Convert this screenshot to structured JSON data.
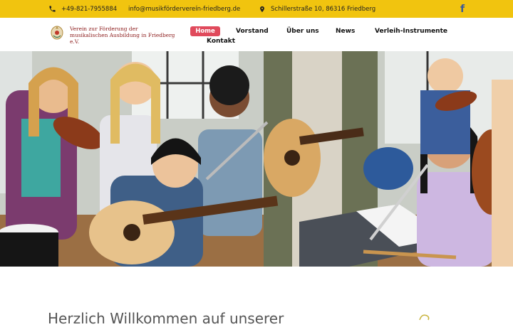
{
  "topbar": {
    "phone": "+49-821-7955884",
    "email": "info@musikfördervereín-friedberg.de",
    "address": "Schillerstraße 10, 86316 Friedberg",
    "social_icon": "facebook-icon",
    "background_color": "#f1c40f"
  },
  "brand": {
    "line1": "Verein zur Förderung der",
    "line2": "musikalischen Ausbildung in Friedberg e.V.",
    "color": "#8b1a1a"
  },
  "nav": {
    "items": [
      "Home",
      "Vorstand",
      "Über uns",
      "News",
      "Verleih-Instrumente",
      "Kontakt"
    ],
    "active_color": "#e04a5c"
  },
  "welcome": {
    "heading": "Herzlich Willkommen auf unserer"
  }
}
